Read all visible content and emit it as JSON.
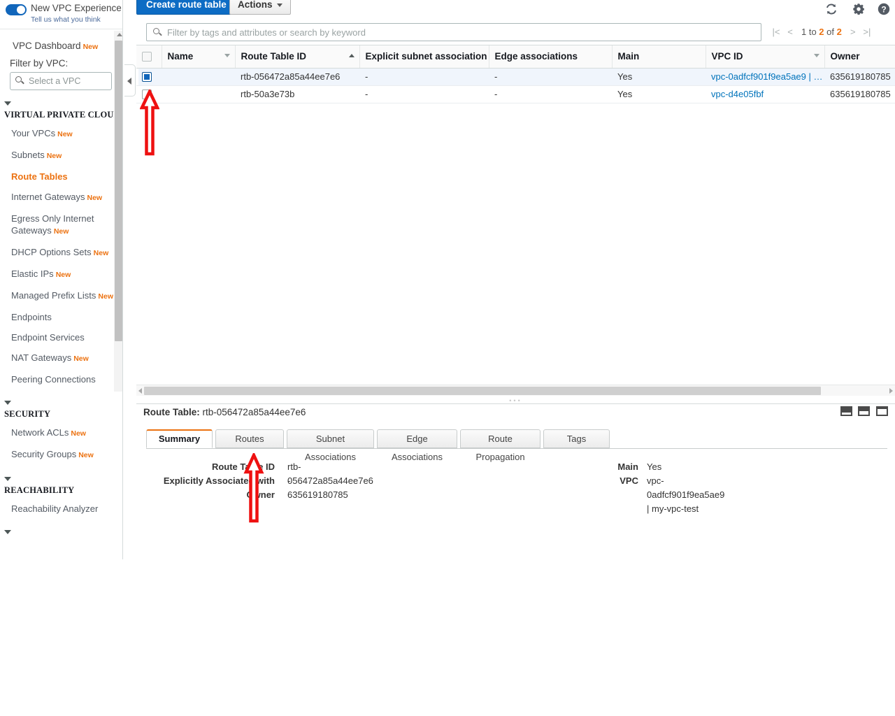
{
  "sidebar": {
    "new_experience": {
      "title": "New VPC Experience",
      "subtitle": "Tell us what you think"
    },
    "dashboard_label": "VPC Dashboard",
    "dashboard_badge": "New",
    "filter_label": "Filter by VPC:",
    "vpc_select_placeholder": "Select a VPC",
    "groups": [
      {
        "title": "VIRTUAL PRIVATE CLOUD",
        "items": [
          {
            "label": "Your VPCs",
            "badge": "New",
            "active": false
          },
          {
            "label": "Subnets",
            "badge": "New",
            "active": false
          },
          {
            "label": "Route Tables",
            "badge": "",
            "active": true
          },
          {
            "label": "Internet Gateways",
            "badge": "New",
            "active": false
          },
          {
            "label": "Egress Only Internet Gateways",
            "badge": "New",
            "active": false
          },
          {
            "label": "DHCP Options Sets",
            "badge": "New",
            "active": false
          },
          {
            "label": "Elastic IPs",
            "badge": "New",
            "active": false
          },
          {
            "label": "Managed Prefix Lists",
            "badge": "New",
            "active": false
          },
          {
            "label": "Endpoints",
            "badge": "",
            "active": false
          },
          {
            "label": "Endpoint Services",
            "badge": "",
            "active": false
          },
          {
            "label": "NAT Gateways",
            "badge": "New",
            "active": false
          },
          {
            "label": "Peering Connections",
            "badge": "",
            "active": false
          }
        ]
      },
      {
        "title": "SECURITY",
        "items": [
          {
            "label": "Network ACLs",
            "badge": "New",
            "active": false
          },
          {
            "label": "Security Groups",
            "badge": "New",
            "active": false
          }
        ]
      },
      {
        "title": "REACHABILITY",
        "items": [
          {
            "label": "Reachability Analyzer",
            "badge": "",
            "active": false
          }
        ]
      }
    ]
  },
  "toolbar": {
    "create_label": "Create route table",
    "actions_label": "Actions",
    "refresh_icon": "refresh-icon",
    "settings_icon": "gear-icon",
    "help_icon": "help-icon"
  },
  "filter": {
    "placeholder": "Filter by tags and attributes or search by keyword",
    "value": "",
    "search_icon": "search-icon"
  },
  "pager": {
    "first": "|<",
    "prev": "<",
    "text_prefix": "1 to ",
    "text_count": "2",
    "text_middle": " of ",
    "text_total": "2",
    "next": ">",
    "last": ">|"
  },
  "table": {
    "columns": [
      "Name",
      "Route Table ID",
      "Explicit subnet association",
      "Edge associations",
      "Main",
      "VPC ID",
      "Owner"
    ],
    "sort_column": "Route Table ID",
    "sort_direction": "asc",
    "rows": [
      {
        "selected": true,
        "name": "",
        "route_table_id": "rtb-056472a85a44ee7e6",
        "explicit_subnet_association": "-",
        "edge_associations": "-",
        "main": "Yes",
        "vpc_id": "vpc-0adfcf901f9ea5ae9 | …",
        "owner": "635619180785"
      },
      {
        "selected": false,
        "name": "",
        "route_table_id": "rtb-50a3e73b",
        "explicit_subnet_association": "-",
        "edge_associations": "-",
        "main": "Yes",
        "vpc_id": "vpc-d4e05fbf",
        "owner": "635619180785"
      }
    ]
  },
  "detail": {
    "title_label": "Route Table:",
    "title_value": "rtb-056472a85a44ee7e6",
    "panel_icons": [
      "panel-small-icon",
      "panel-medium-icon",
      "panel-large-icon"
    ],
    "tabs": [
      {
        "label": "Summary",
        "active": true
      },
      {
        "label": "Routes",
        "active": false
      },
      {
        "label": "Subnet Associations",
        "active": false
      },
      {
        "label": "Edge Associations",
        "active": false
      },
      {
        "label": "Route Propagation",
        "active": false
      },
      {
        "label": "Tags",
        "active": false
      }
    ],
    "summary_left": [
      {
        "key": "Route Table ID",
        "value": "rtb-056472a85a44ee7e6",
        "is_link": false
      },
      {
        "key": "Explicitly Associated with",
        "value": "-",
        "is_link": false
      },
      {
        "key": "Owner",
        "value": "635619180785",
        "is_link": false
      }
    ],
    "summary_right": [
      {
        "key": "Main",
        "value": "Yes",
        "is_link": false
      },
      {
        "key": "VPC",
        "value": "vpc-0adfcf901f9ea5ae9 | my-vpc-test",
        "is_link": true
      }
    ]
  },
  "annotations": {
    "color": "#ee1111",
    "arrows": [
      {
        "name": "arrow-to-row-checkbox",
        "points_at": "selected row checkbox"
      },
      {
        "name": "arrow-to-routes-tab",
        "points_at": "Routes tab"
      }
    ]
  },
  "colors": {
    "accent_orange": "#ec7211",
    "link_blue": "#0073bb",
    "primary_button": "#0d6cc4",
    "selected_row": "#f0f5fc",
    "annotation_red": "#ee1111"
  }
}
